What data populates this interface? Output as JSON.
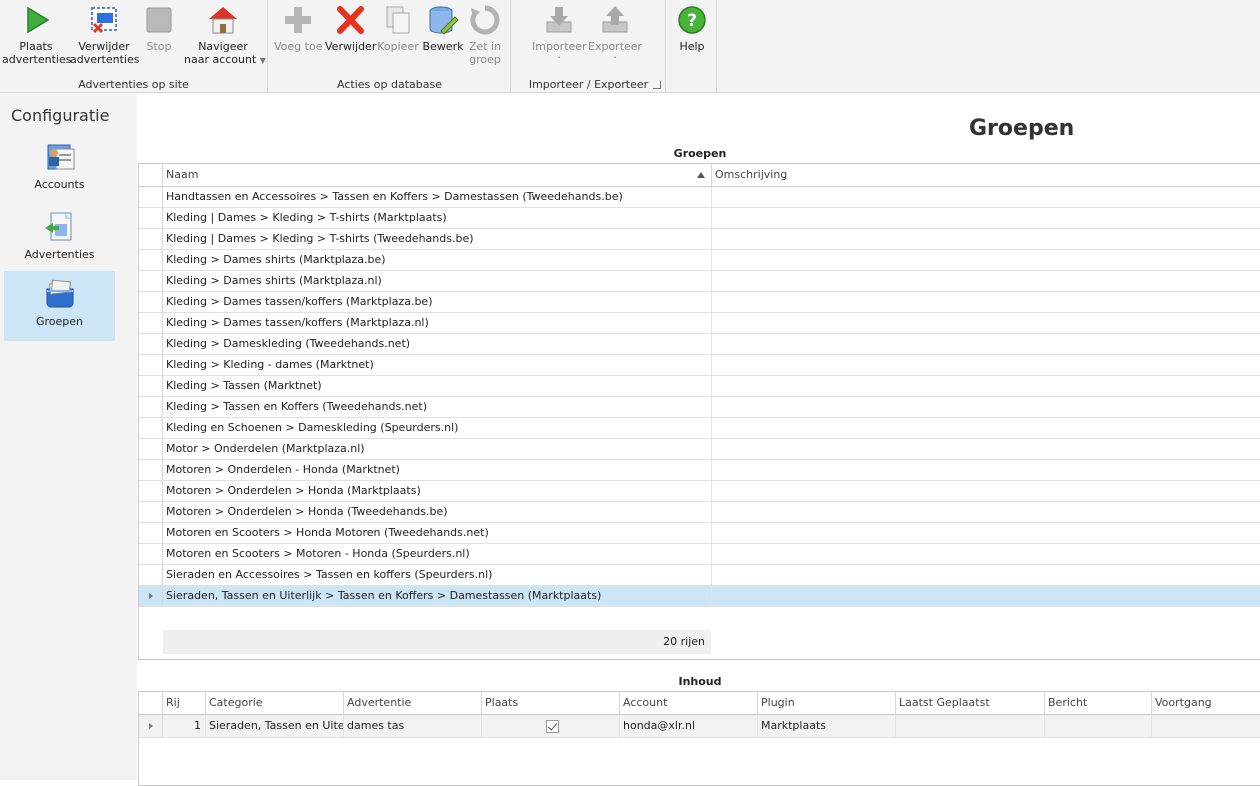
{
  "ribbon": {
    "groups": [
      {
        "label": "Advertenties op site"
      },
      {
        "label": "Acties op database"
      },
      {
        "label": "Importeer / Exporteer"
      },
      {
        "label": ""
      }
    ],
    "buttons": {
      "plaats": {
        "line1": "Plaats",
        "line2": "advertenties"
      },
      "verwijder_adv": {
        "line1": "Verwijder",
        "line2": "advertenties"
      },
      "stop": {
        "line1": "Stop"
      },
      "navigeer": {
        "line1": "Navigeer",
        "line2": "naar account"
      },
      "voeg_toe": {
        "line1": "Voeg toe"
      },
      "verwijder": {
        "line1": "Verwijder"
      },
      "kopieer": {
        "line1": "Kopieer"
      },
      "bewerk": {
        "line1": "Bewerk"
      },
      "zet_in_groep": {
        "line1": "Zet in",
        "line2": "groep"
      },
      "importeer": {
        "line1": "Importeer"
      },
      "exporteer": {
        "line1": "Exporteer"
      },
      "help": {
        "line1": "Help"
      }
    }
  },
  "sidebar": {
    "title": "Configuratie",
    "items": [
      {
        "label": "Accounts"
      },
      {
        "label": "Advertenties"
      },
      {
        "label": "Groepen"
      }
    ]
  },
  "main": {
    "title": "Groepen",
    "groups_grid": {
      "caption": "Groepen",
      "columns": [
        "Naam",
        "Omschrijving"
      ],
      "rows": [
        "Handtassen en Accessoires > Tassen en Koffers > Damestassen (Tweedehands.be)",
        "Kleding | Dames > Kleding > T-shirts (Marktplaats)",
        "Kleding | Dames > Kleding > T-shirts (Tweedehands.be)",
        "Kleding > Dames shirts (Marktplaza.be)",
        "Kleding > Dames shirts (Marktplaza.nl)",
        "Kleding > Dames tassen/koffers (Marktplaza.be)",
        "Kleding > Dames tassen/koffers (Marktplaza.nl)",
        "Kleding > Dameskleding (Tweedehands.net)",
        "Kleding > Kleding - dames (Marktnet)",
        "Kleding > Tassen (Marktnet)",
        "Kleding > Tassen en Koffers (Tweedehands.net)",
        "Kleding en Schoenen > Dameskleding (Speurders.nl)",
        "Motor > Onderdelen (Marktplaza.nl)",
        "Motoren > Onderdelen - Honda (Marktnet)",
        "Motoren > Onderdelen > Honda (Marktplaats)",
        "Motoren > Onderdelen > Honda (Tweedehands.be)",
        "Motoren en Scooters > Honda Motoren (Tweedehands.net)",
        "Motoren en Scooters > Motoren - Honda (Speurders.nl)",
        "Sieraden en Accessoires > Tassen en koffers (Speurders.nl)",
        "Sieraden, Tassen en Uiterlijk > Tassen en Koffers > Damestassen (Marktplaats)"
      ],
      "selected_row": 19,
      "footer": "20 rijen"
    },
    "content_grid": {
      "caption": "Inhoud",
      "columns": [
        "Rij",
        "Categorie",
        "Advertentie",
        "Plaats",
        "Account",
        "Plugin",
        "Laatst Geplaatst",
        "Bericht",
        "Voortgang"
      ],
      "row": {
        "rij": "1",
        "categorie": "Sieraden, Tassen en Uite...",
        "advertentie": "dames tas",
        "plaats_checked": true,
        "account": "honda@xlr.nl",
        "plugin": "Marktplaats",
        "laatst_geplaatst": "",
        "bericht": "",
        "voortgang": ""
      }
    }
  },
  "colors": {
    "ribbon_bg": "#f3f3f3",
    "selection": "#cde6f7",
    "grid_border": "#c8c8c8"
  },
  "icons": {
    "plaats": "play-icon",
    "verwijder_adv": "remove-ads-icon",
    "stop": "stop-icon",
    "navigeer": "home-icon",
    "voeg_toe": "plus-icon",
    "verwijder": "delete-x-icon",
    "kopieer": "copy-icon",
    "bewerk": "database-edit-icon",
    "zet_in_groep": "refresh-group-icon",
    "importeer": "import-icon",
    "exporteer": "export-icon",
    "help": "help-icon",
    "accounts": "accounts-icon",
    "advertenties": "advertenties-icon",
    "groepen": "groepen-icon"
  }
}
